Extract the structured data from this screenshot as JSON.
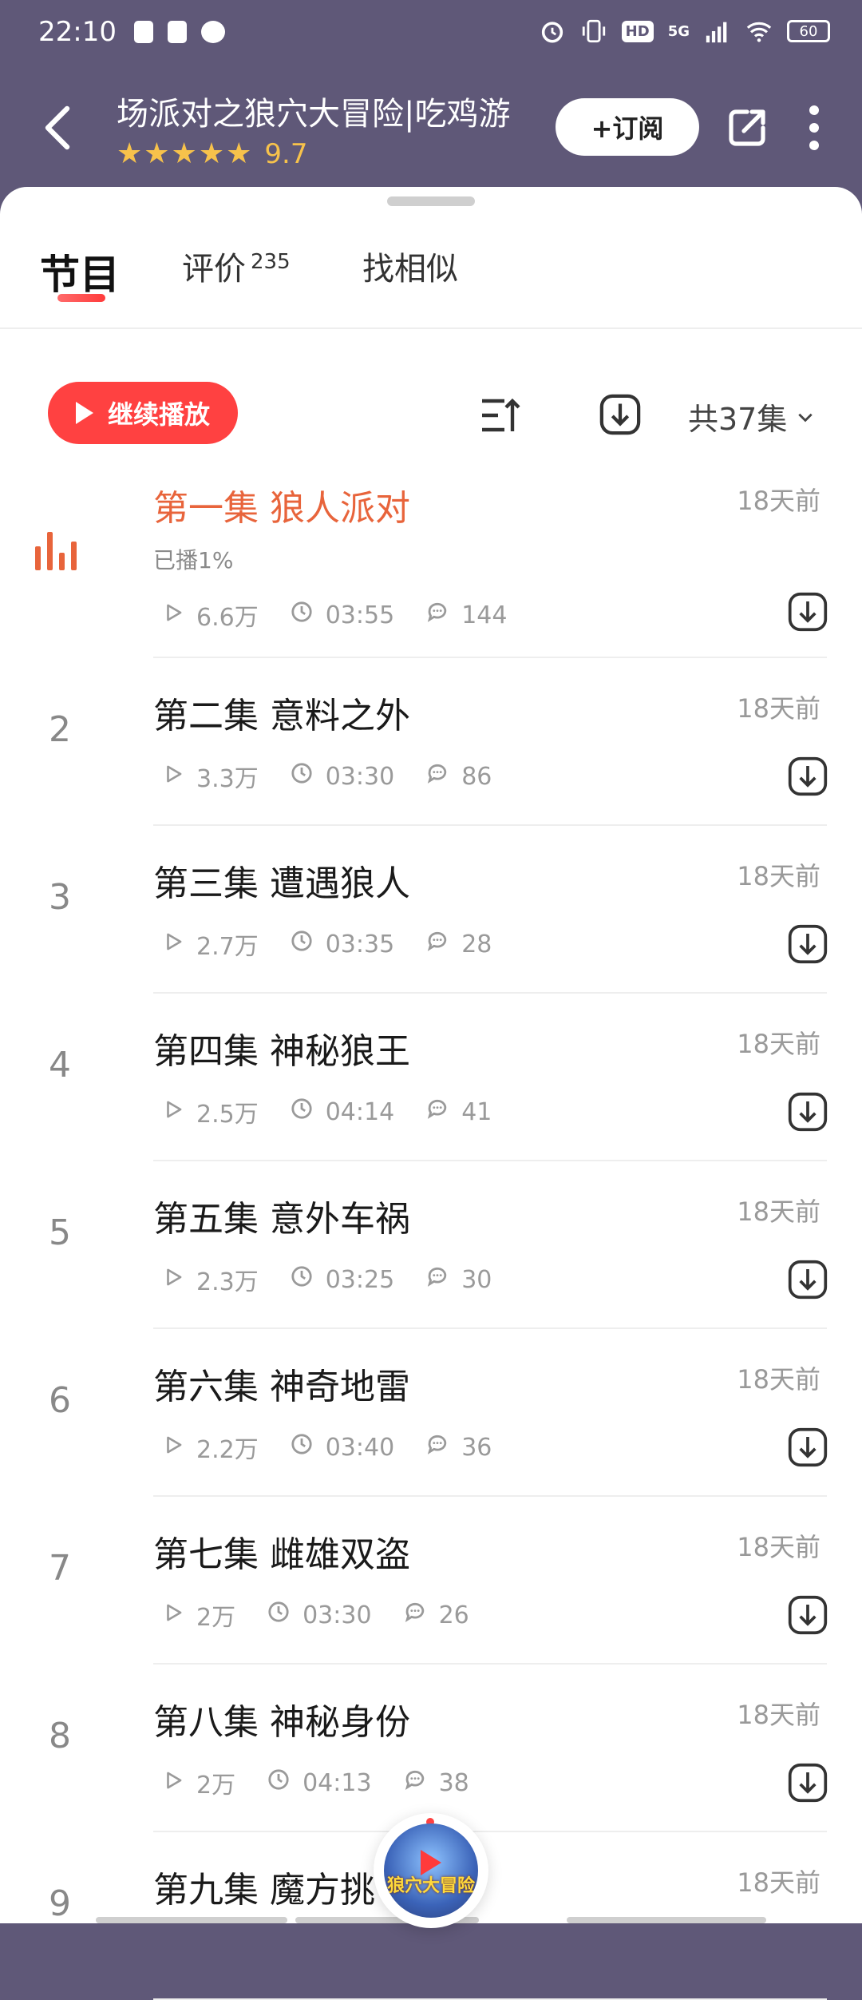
{
  "status_bar": {
    "time": "22:10",
    "network": "5G",
    "hd": "HD",
    "battery": "60"
  },
  "header": {
    "title": "场派对之狼穴大冒险|吃鸡游",
    "stars": "★★★★★",
    "score": "9.7",
    "subscribe_label": "+订阅"
  },
  "tabs": [
    {
      "label": "节目",
      "badge": ""
    },
    {
      "label": "评价",
      "badge": "235"
    },
    {
      "label": "找相似",
      "badge": ""
    }
  ],
  "toolbar": {
    "continue_label": "继续播放",
    "count_label": "共37集"
  },
  "episodes": [
    {
      "index": "",
      "title": "第一集 狼人派对",
      "time": "18天前",
      "progress": "已播1%",
      "plays": "6.6万",
      "duration": "03:55",
      "comments": "144",
      "playing": true
    },
    {
      "index": "2",
      "title": "第二集 意料之外",
      "time": "18天前",
      "plays": "3.3万",
      "duration": "03:30",
      "comments": "86"
    },
    {
      "index": "3",
      "title": "第三集 遭遇狼人",
      "time": "18天前",
      "plays": "2.7万",
      "duration": "03:35",
      "comments": "28"
    },
    {
      "index": "4",
      "title": "第四集 神秘狼王",
      "time": "18天前",
      "plays": "2.5万",
      "duration": "04:14",
      "comments": "41"
    },
    {
      "index": "5",
      "title": "第五集 意外车祸",
      "time": "18天前",
      "plays": "2.3万",
      "duration": "03:25",
      "comments": "30"
    },
    {
      "index": "6",
      "title": "第六集 神奇地雷",
      "time": "18天前",
      "plays": "2.2万",
      "duration": "03:40",
      "comments": "36"
    },
    {
      "index": "7",
      "title": "第七集 雌雄双盗",
      "time": "18天前",
      "plays": "2万",
      "duration": "03:30",
      "comments": "26"
    },
    {
      "index": "8",
      "title": "第八集 神秘身份",
      "time": "18天前",
      "plays": "2万",
      "duration": "04:13",
      "comments": "38"
    },
    {
      "index": "9",
      "title": "第九集 魔方挑",
      "time": "18天前",
      "plays": "",
      "duration": "",
      "comments": ""
    }
  ],
  "mini_player": {
    "cover_text": "狼穴大冒险"
  },
  "colors": {
    "header_bg": "#5f5878",
    "accent": "#ff4141",
    "playing": "#e8643b",
    "star": "#f7c24b"
  }
}
